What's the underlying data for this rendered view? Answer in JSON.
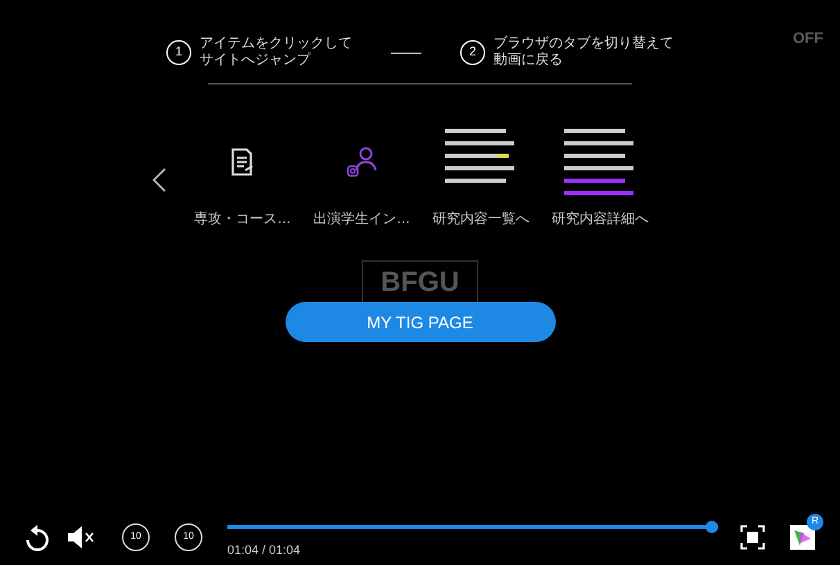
{
  "steps": [
    {
      "number": "1",
      "lines": [
        "アイテムをクリックして",
        "サイトへジャンプ"
      ]
    },
    {
      "number": "2",
      "lines": [
        "ブラウザのタブを切り替えて",
        "動画に戻る"
      ]
    }
  ],
  "toggle": {
    "label": "OFF",
    "on": false
  },
  "items": [
    {
      "kind": "document",
      "label": "専攻・コース…"
    },
    {
      "kind": "person",
      "label": "出演学生イン…"
    },
    {
      "kind": "picture",
      "label": "研究内容一覧へ"
    },
    {
      "kind": "picture",
      "label": "研究内容詳細へ"
    }
  ],
  "logo": "BFGU",
  "button": "MY TIG PAGE",
  "player": {
    "muted": true,
    "progress": {
      "level": 1
    },
    "time": "01:04 / 01:04",
    "skip_back": "10",
    "skip_forward": "10",
    "badge": "R"
  }
}
